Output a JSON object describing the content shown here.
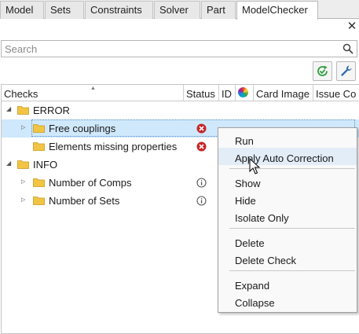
{
  "tabs": [
    {
      "label": "Model"
    },
    {
      "label": "Sets"
    },
    {
      "label": "Constraints"
    },
    {
      "label": "Solver"
    },
    {
      "label": "Part"
    },
    {
      "label": "ModelChecker",
      "active": true
    }
  ],
  "panel": {
    "close_glyph": "✕",
    "search_placeholder": "Search",
    "search_value": ""
  },
  "toolbar": {
    "buttons": [
      {
        "icon": "refresh-check-icon"
      },
      {
        "icon": "wrench-icon"
      }
    ]
  },
  "table": {
    "columns": [
      {
        "label": "Checks"
      },
      {
        "label": "Status"
      },
      {
        "label": "ID"
      },
      {
        "label": "",
        "icon": "color-wheel-icon"
      },
      {
        "label": "Card Image"
      },
      {
        "label": "Issue Co"
      }
    ],
    "rows": [
      {
        "label": "ERROR",
        "level": 0,
        "expanded": true
      },
      {
        "label": "Free couplings",
        "level": 1,
        "status": "error",
        "selected": true
      },
      {
        "label": "Elements missing properties",
        "level": 1,
        "status": "error"
      },
      {
        "label": "INFO",
        "level": 0,
        "expanded": true
      },
      {
        "label": "Number of Comps",
        "level": 1,
        "status": "info"
      },
      {
        "label": "Number of Sets",
        "level": 1,
        "status": "info"
      }
    ]
  },
  "context_menu": {
    "items": [
      {
        "label": "Run"
      },
      {
        "label": "Apply Auto Correction",
        "hover": true
      },
      {
        "label": "Show"
      },
      {
        "label": "Hide"
      },
      {
        "label": "Isolate Only"
      },
      {
        "label": "Delete"
      },
      {
        "label": "Delete Check"
      },
      {
        "label": "Expand"
      },
      {
        "label": "Collapse"
      }
    ]
  },
  "colors": {
    "error_red": "#c62828",
    "info_gray": "#555555",
    "folder_yellow": "#f2c443",
    "selection_blue": "#cfe8fb",
    "refresh_green": "#2e9e3e",
    "wrench_blue": "#2f6fb3"
  }
}
